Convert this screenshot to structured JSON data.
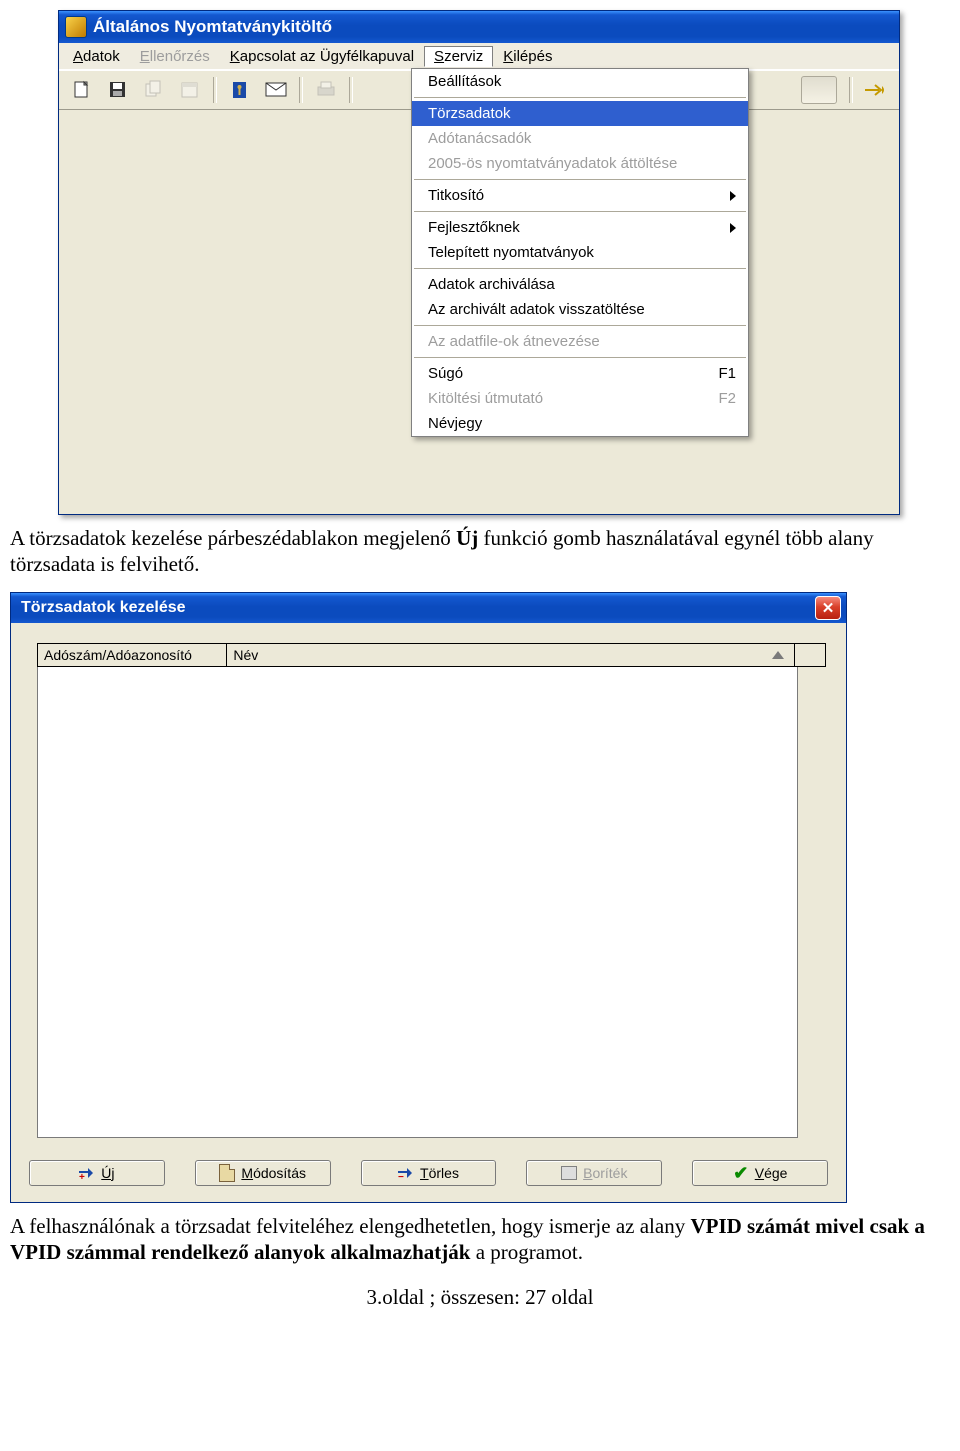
{
  "app": {
    "title": "Általános Nyomtatványkitöltő",
    "menubar": {
      "adatok": "Adatok",
      "ellenorzes": "Ellenőrzés",
      "kapcsolat": "Kapcsolat az Ügyfélkapuval",
      "szerviz": "Szerviz",
      "kilepes": "Kilépés"
    },
    "dropdown": {
      "beallitasok": "Beállítások",
      "torzsadatok": "Törzsadatok",
      "adotanacsadok": "Adótanácsadók",
      "attoltes": "2005-ös nyomtatványadatok áttöltése",
      "titkosito": "Titkosító",
      "fejlesztoknek": "Fejlesztőknek",
      "telepitett": "Telepített nyomtatványok",
      "archivalas": "Adatok archiválása",
      "visszatoltes": "Az archivált adatok visszatöltése",
      "atnevezes": "Az adatfile-ok átnevezése",
      "sugo": "Súgó",
      "sugo_key": "F1",
      "utmutato": "Kitöltési útmutató",
      "utmutato_key": "F2",
      "nevjegy": "Névjegy"
    }
  },
  "para1_a": "A törzsadatok kezelése párbeszédablakon megjelenő ",
  "para1_b": "Új",
  "para1_c": " funkció gomb használatával egynél több alany törzsadata is felvihető.",
  "dialog": {
    "title": "Törzsadatok kezelése",
    "col1": "Adószám/Adóazonosító",
    "col2": "Név",
    "buttons": {
      "uj": "Új",
      "modositas": "Módosítás",
      "torles": "Törles",
      "boritek": "Boríték",
      "vege": "Vége"
    }
  },
  "para2_a": "A felhasználónak a törzsadat felviteléhez elengedhetetlen, hogy ismerje az alany ",
  "para2_b": "VPID számát mivel csak a VPID számmal rendelkező alanyok alkalmazhatják",
  "para2_c": " a programot.",
  "footer": "3.oldal ; összesen: 27 oldal"
}
